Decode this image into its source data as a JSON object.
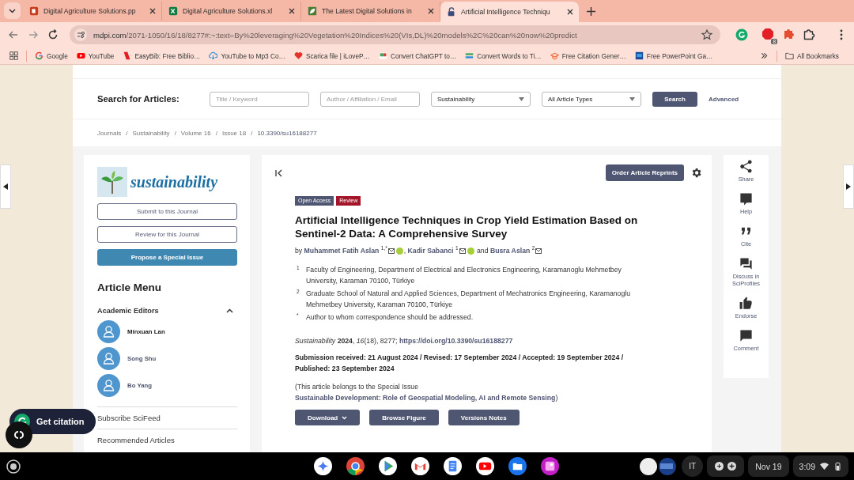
{
  "browser": {
    "tabs": [
      {
        "kind": "ppt",
        "title": "Digital Agriculture Solutions.pp",
        "selected": false
      },
      {
        "kind": "xls",
        "title": "Digital Agriculture Solutions.xl",
        "selected": false
      },
      {
        "kind": "leaf",
        "title": "The Latest Digital Solutions in",
        "selected": false
      },
      {
        "kind": "lock",
        "title": "Artificial Intelligence Techniqu",
        "selected": true
      }
    ],
    "url_host": "mdpi.com",
    "url_path": "/2071-1050/16/18/8277#:~:text=By%20leveraging%20Vegetation%20Indices%20(VIs,DL)%20models%2C%20can%20now%20predict",
    "extension_badge": "8",
    "bookmarks": [
      {
        "kind": "google",
        "label": "Google"
      },
      {
        "kind": "youtube",
        "label": "YouTube"
      },
      {
        "kind": "easybib",
        "label": "EasyBib: Free Biblio…"
      },
      {
        "kind": "download",
        "label": "YouTube to Mp3 Co…"
      },
      {
        "kind": "heart",
        "label": "Scarica file | iLoveP…"
      },
      {
        "kind": "convert",
        "label": "Convert ChatGPT to…"
      },
      {
        "kind": "words",
        "label": "Convert Words to Ti…"
      },
      {
        "kind": "cap",
        "label": "Free Citation Gener…"
      },
      {
        "kind": "slides",
        "label": "Free PowerPoint Ga…"
      }
    ],
    "all_bookmarks": "All Bookmarks"
  },
  "search": {
    "label": "Search for Articles:",
    "fields": [
      {
        "placeholder": "Title / Keyword"
      },
      {
        "placeholder": "Author / Affiliation / Email"
      }
    ],
    "selects": [
      {
        "value": "Sustainability"
      },
      {
        "value": "All Article Types"
      }
    ],
    "button": "Search",
    "advanced": "Advanced"
  },
  "breadcrumb": {
    "separator": "/",
    "items": [
      "Journals",
      "Sustainability",
      "Volume 16",
      "Issue 18",
      "10.3390/su16188277"
    ]
  },
  "sidebar": {
    "journal": "sustainability",
    "buttons": [
      {
        "kind": "outline",
        "label": "Submit to this Journal"
      },
      {
        "kind": "outline",
        "label": "Review for this Journal"
      },
      {
        "kind": "filled",
        "label": "Propose a Special Issue"
      }
    ],
    "menu_title": "Article Menu",
    "editors_section": {
      "title": "Academic Editors",
      "expanded": true,
      "editors": [
        {
          "name": "Minxuan Lan",
          "selected": true
        },
        {
          "name": "Song Shu",
          "selected": false
        },
        {
          "name": "Bo Yang",
          "selected": false
        }
      ]
    },
    "links": [
      "Subscribe SciFeed",
      "Recommended Articles"
    ]
  },
  "article": {
    "reprints_button": "Order Article Reprints",
    "badges": [
      {
        "label": "Open Access",
        "color": "#4f5671"
      },
      {
        "label": "Review",
        "color": "#a3162a"
      }
    ],
    "title": "Artificial Intelligence Techniques in Crop Yield Estimation Based on Sentinel-2 Data: A Comprehensive Survey",
    "byline": {
      "prefix": "by",
      "separator": ",",
      "connector": "and",
      "authors": [
        {
          "name": "Muhammet Fatih Aslan",
          "mark": "1,*",
          "orcid": true
        },
        {
          "name": "Kadir Sabanci",
          "mark": "1",
          "orcid": true
        },
        {
          "name": "Busra Aslan",
          "mark": "2",
          "orcid": false
        }
      ]
    },
    "affiliations": [
      {
        "mark": "1",
        "text": "Faculty of Engineering, Department of Electrical and Electronics Engineering, Karamanoglu Mehmetbey University, Karaman 70100, Türkiye"
      },
      {
        "mark": "2",
        "text": "Graduate School of Natural and Applied Sciences, Department of Mechatronics Engineering, Karamanoglu Mehmetbey University, Karaman 70100, Türkiye"
      },
      {
        "mark": "*",
        "text": "Author to whom correspondence should be addressed."
      }
    ],
    "citation": "*Sustainability* **2024**, *16*(18), 8277; ",
    "doi": "https://doi.org/10.3390/su16188277",
    "dates": "Submission received: 21 August 2024 / Revised: 17 September 2024 / Accepted: 19 September 2024 / Published: 23 September 2024",
    "special_issue": {
      "prefix": "(This article belongs to the Special Issue",
      "link": "Sustainable Development: Role of Geospatial Modeling, AI and Remote Sensing",
      "suffix": ")"
    },
    "buttons": [
      {
        "label": "Download",
        "dropdown": true
      },
      {
        "label": "Browse Figure",
        "dropdown": false
      },
      {
        "label": "Versions Notes",
        "dropdown": false
      }
    ]
  },
  "actions": [
    {
      "kind": "share",
      "label": "Share"
    },
    {
      "kind": "help",
      "label": "Help"
    },
    {
      "kind": "cite",
      "label": "Cite"
    },
    {
      "kind": "discuss",
      "label": "Discuss in SciProfiles"
    },
    {
      "kind": "endorse",
      "label": "Endorse"
    },
    {
      "kind": "comment",
      "label": "Comment"
    }
  ],
  "floating": {
    "citation_button": "Get citation"
  },
  "taskbar": {
    "language": "IT",
    "date": "Nov 19",
    "time": "3:09"
  }
}
